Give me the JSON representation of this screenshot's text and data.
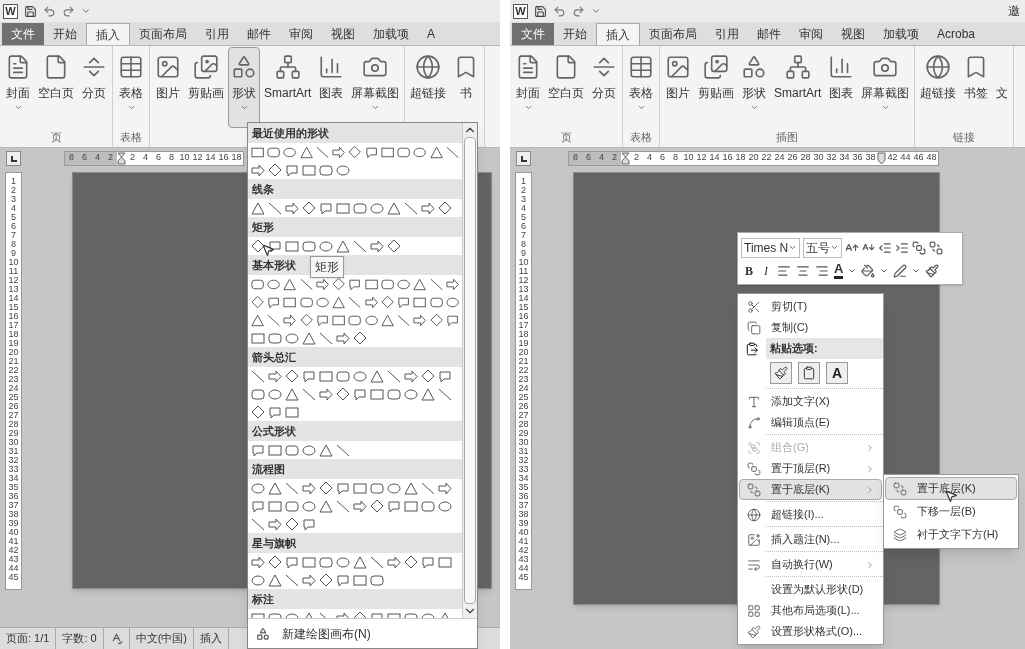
{
  "left_window": {
    "logo": "W",
    "tabs": [
      {
        "label": "文件",
        "kind": "file",
        "selected": false
      },
      {
        "label": "开始",
        "kind": "tab",
        "selected": false
      },
      {
        "label": "插入",
        "kind": "tab",
        "selected": true
      },
      {
        "label": "页面布局",
        "kind": "tab",
        "selected": false
      },
      {
        "label": "引用",
        "kind": "tab",
        "selected": false
      },
      {
        "label": "邮件",
        "kind": "tab",
        "selected": false
      },
      {
        "label": "审阅",
        "kind": "tab",
        "selected": false
      },
      {
        "label": "视图",
        "kind": "tab",
        "selected": false
      },
      {
        "label": "加载项",
        "kind": "tab",
        "selected": false
      },
      {
        "label": "A",
        "kind": "tab",
        "selected": false
      }
    ],
    "ribbon": [
      {
        "label": "页",
        "buttons": [
          {
            "label": "封面",
            "dropdown": true,
            "pressed": false
          },
          {
            "label": "空白页",
            "dropdown": false,
            "pressed": false
          },
          {
            "label": "分页",
            "dropdown": false,
            "pressed": false
          }
        ]
      },
      {
        "label": "表格",
        "buttons": [
          {
            "label": "表格",
            "dropdown": true,
            "pressed": false
          }
        ]
      },
      {
        "buttons": [
          {
            "label": "图片",
            "dropdown": false,
            "pressed": false
          },
          {
            "label": "剪贴画",
            "dropdown": false,
            "pressed": false
          },
          {
            "label": "形状",
            "dropdown": true,
            "pressed": true
          },
          {
            "label": "SmartArt",
            "dropdown": false,
            "pressed": false
          },
          {
            "label": "图表",
            "dropdown": false,
            "pressed": false
          },
          {
            "label": "屏幕截图",
            "dropdown": true,
            "pressed": false
          }
        ]
      },
      {
        "buttons": [
          {
            "label": "超链接",
            "dropdown": false,
            "pressed": false
          },
          {
            "label": "书",
            "dropdown": false,
            "pressed": false
          }
        ]
      }
    ],
    "ruler": {
      "before": [
        "8",
        "6",
        "4",
        "2"
      ],
      "after": [
        "2",
        "4",
        "6",
        "8",
        "10",
        "12",
        "14",
        "16",
        "18"
      ]
    },
    "vertical_ruler": [
      "1",
      "2",
      "3",
      "4",
      "5",
      "6",
      "7",
      "8",
      "9",
      "10",
      "11",
      "12",
      "13",
      "14",
      "15",
      "16",
      "17",
      "18",
      "19",
      "20",
      "21",
      "22",
      "23",
      "24",
      "25",
      "26",
      "27",
      "28",
      "29",
      "30",
      "31",
      "32",
      "33",
      "34",
      "35",
      "36",
      "37",
      "38",
      "39",
      "40",
      "41",
      "42",
      "43",
      "44",
      "45"
    ],
    "shapes_menu": {
      "sections": [
        {
          "title": "最近使用的形状"
        },
        {
          "title": "线条"
        },
        {
          "title": "矩形"
        },
        {
          "title": "基本形状"
        },
        {
          "title": "箭头总汇"
        },
        {
          "title": "公式形状"
        },
        {
          "title": "流程图"
        },
        {
          "title": "星与旗帜"
        },
        {
          "title": "标注"
        }
      ],
      "tooltip": "矩形",
      "footer": "新建绘图画布(N)"
    },
    "status_bar": [
      {
        "kind": "text",
        "label": "页面: 1/1"
      },
      {
        "kind": "text",
        "label": "字数: 0"
      },
      {
        "kind": "icon"
      },
      {
        "kind": "text",
        "label": "中文(中国)"
      },
      {
        "kind": "text",
        "label": "插入"
      }
    ]
  },
  "right_window": {
    "logo": "W",
    "title": "邀",
    "tabs": [
      {
        "label": "文件",
        "kind": "file",
        "selected": false
      },
      {
        "label": "开始",
        "kind": "tab",
        "selected": false
      },
      {
        "label": "插入",
        "kind": "tab",
        "selected": true
      },
      {
        "label": "页面布局",
        "kind": "tab",
        "selected": false
      },
      {
        "label": "引用",
        "kind": "tab",
        "selected": false
      },
      {
        "label": "邮件",
        "kind": "tab",
        "selected": false
      },
      {
        "label": "审阅",
        "kind": "tab",
        "selected": false
      },
      {
        "label": "视图",
        "kind": "tab",
        "selected": false
      },
      {
        "label": "加载项",
        "kind": "tab",
        "selected": false
      },
      {
        "label": "Acroba",
        "kind": "tab",
        "selected": false
      }
    ],
    "ribbon": [
      {
        "label": "页",
        "buttons": [
          {
            "label": "封面",
            "dropdown": true,
            "pressed": false
          },
          {
            "label": "空白页",
            "dropdown": false,
            "pressed": false
          },
          {
            "label": "分页",
            "dropdown": false,
            "pressed": false
          }
        ]
      },
      {
        "label": "表格",
        "buttons": [
          {
            "label": "表格",
            "dropdown": true,
            "pressed": false
          }
        ]
      },
      {
        "label": "插图",
        "buttons": [
          {
            "label": "图片",
            "dropdown": false,
            "pressed": false
          },
          {
            "label": "剪贴画",
            "dropdown": false,
            "pressed": false
          },
          {
            "label": "形状",
            "dropdown": true,
            "pressed": false
          },
          {
            "label": "SmartArt",
            "dropdown": false,
            "pressed": false
          },
          {
            "label": "图表",
            "dropdown": false,
            "pressed": false
          },
          {
            "label": "屏幕截图",
            "dropdown": true,
            "pressed": false
          }
        ]
      },
      {
        "label": "链接",
        "buttons": [
          {
            "label": "超链接",
            "dropdown": false,
            "pressed": false
          },
          {
            "label": "书签",
            "dropdown": false,
            "pressed": false
          },
          {
            "label": "文",
            "dropdown": false,
            "pressed": false
          }
        ]
      }
    ],
    "ruler": {
      "before": [
        "8",
        "6",
        "4",
        "2"
      ],
      "after": [
        "2",
        "4",
        "6",
        "8",
        "10",
        "12",
        "14",
        "16",
        "18",
        "20",
        "22",
        "24",
        "26",
        "28",
        "30",
        "32",
        "34",
        "36",
        "38"
      ],
      "end": [
        "42",
        "44",
        "46",
        "48"
      ]
    },
    "vertical_ruler": [
      "1",
      "2",
      "3",
      "4",
      "5",
      "6",
      "7",
      "8",
      "9",
      "10",
      "11",
      "12",
      "13",
      "14",
      "15",
      "16",
      "17",
      "18",
      "19",
      "20",
      "21",
      "22",
      "23",
      "24",
      "25",
      "26",
      "27",
      "28",
      "29",
      "30",
      "31",
      "32",
      "33",
      "34",
      "35",
      "36",
      "37",
      "38",
      "39",
      "40",
      "41",
      "42",
      "43",
      "44",
      "45"
    ],
    "mini_toolbar": {
      "font": "Times N",
      "size": "五号",
      "bold": "B",
      "italic": "I",
      "font_color": "A"
    },
    "context_menu": [
      {
        "kind": "item",
        "label": "剪切(T)",
        "submenu": false,
        "disabled": false,
        "selected": false
      },
      {
        "kind": "item",
        "label": "复制(C)",
        "submenu": false,
        "disabled": false,
        "selected": false
      },
      {
        "kind": "header",
        "label": "粘贴选项:"
      },
      {
        "kind": "paste",
        "buttons": [
          {
            "kind": "icon"
          },
          {
            "kind": "icon"
          },
          {
            "kind": "text",
            "label": "A"
          }
        ]
      },
      {
        "kind": "separator"
      },
      {
        "kind": "item",
        "label": "添加文字(X)",
        "submenu": false,
        "disabled": false,
        "selected": false
      },
      {
        "kind": "item",
        "label": "编辑顶点(E)",
        "submenu": false,
        "disabled": false,
        "selected": false
      },
      {
        "kind": "separator"
      },
      {
        "kind": "item",
        "label": "组合(G)",
        "submenu": true,
        "disabled": true,
        "selected": false
      },
      {
        "kind": "item",
        "label": "置于顶层(R)",
        "submenu": true,
        "disabled": false,
        "selected": false
      },
      {
        "kind": "item",
        "label": "置于底层(K)",
        "submenu": true,
        "disabled": false,
        "selected": true
      },
      {
        "kind": "separator"
      },
      {
        "kind": "item",
        "label": "超链接(I)...",
        "submenu": false,
        "disabled": false,
        "selected": false
      },
      {
        "kind": "separator"
      },
      {
        "kind": "item",
        "label": "插入题注(N)...",
        "submenu": false,
        "disabled": false,
        "selected": false
      },
      {
        "kind": "separator"
      },
      {
        "kind": "item",
        "label": "自动换行(W)",
        "submenu": true,
        "disabled": false,
        "selected": false
      },
      {
        "kind": "separator"
      },
      {
        "kind": "item",
        "label": "设置为默认形状(D)",
        "submenu": false,
        "disabled": false,
        "selected": false
      },
      {
        "kind": "item",
        "label": "其他布局选项(L)...",
        "submenu": false,
        "disabled": false,
        "selected": false
      },
      {
        "kind": "item",
        "label": "设置形状格式(O)...",
        "submenu": false,
        "disabled": false,
        "selected": false
      }
    ],
    "submenu": [
      {
        "label": "置于底层(K)",
        "selected": true
      },
      {
        "label": "下移一层(B)",
        "selected": false
      },
      {
        "label": "衬于文字下方(H)",
        "selected": false
      }
    ]
  }
}
